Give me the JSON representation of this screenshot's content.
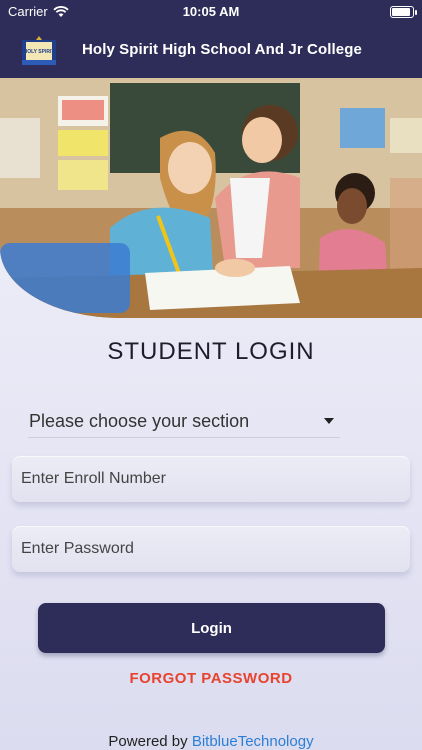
{
  "status_bar": {
    "carrier": "Carrier",
    "time": "10:05 AM",
    "wifi_icon": "wifi-icon",
    "battery_icon": "battery-icon"
  },
  "app_bar": {
    "title": "Holy Spirit High School And Jr College",
    "logo_icon": "school-crest-icon",
    "logo_text": "HOLY SPIRIT"
  },
  "hero": {
    "image": "classroom-teacher-and-students-photo"
  },
  "login": {
    "heading": "STUDENT LOGIN",
    "section_select": {
      "value": "Please choose your section"
    },
    "enroll_field": {
      "placeholder": "Enter Enroll Number",
      "value": ""
    },
    "password_field": {
      "placeholder": "Enter Password",
      "value": ""
    },
    "login_button": "Login",
    "forgot_password": "FORGOT PASSWORD"
  },
  "footer": {
    "powered_prefix": "Powered by",
    "brand_part1": "Bitblue",
    "brand_part2": "Technology"
  },
  "colors": {
    "primary": "#2e2c58",
    "accent_red": "#e8432f",
    "link_blue": "#2b7fd6"
  }
}
